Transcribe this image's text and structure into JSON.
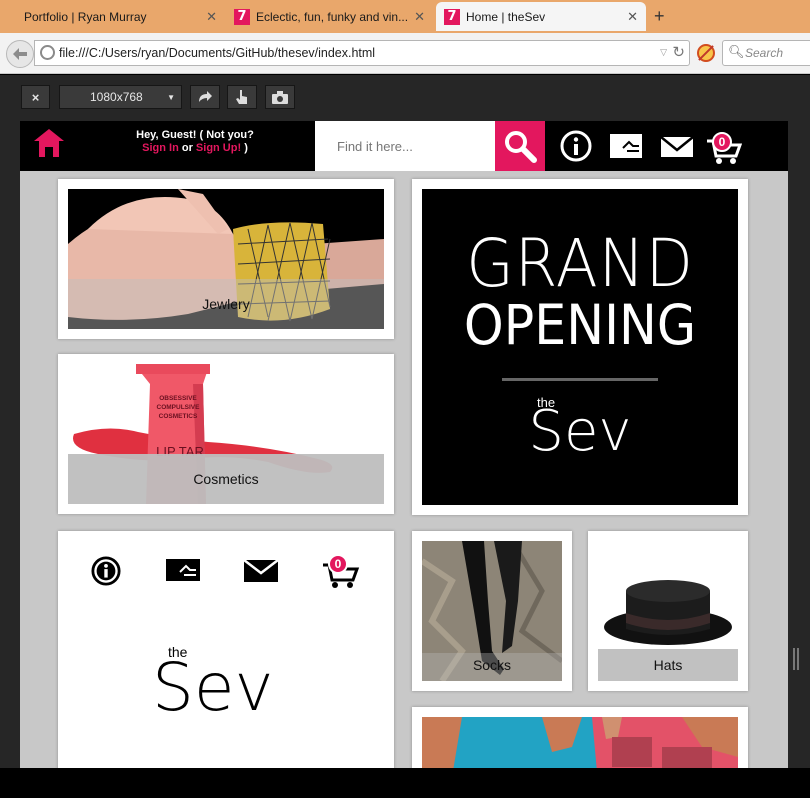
{
  "browser": {
    "tabs": [
      {
        "label": "Portfolio | Ryan Murray",
        "active": false
      },
      {
        "label": "Eclectic, fun, funky and vin...",
        "active": false
      },
      {
        "label": "Home | theSev",
        "active": true
      }
    ],
    "favicon_text": "7",
    "url": "file:///C:/Users/ryan/Documents/GitHub/thesev/index.html",
    "search_placeholder": "Search"
  },
  "responsive_toolbar": {
    "close_label": "×",
    "device_size": "1080x768"
  },
  "site": {
    "colors": {
      "accent": "#e3175e",
      "header_bg": "#000000",
      "tile_bg": "#ffffff",
      "page_bg": "#c8c8c8"
    },
    "header": {
      "greeting_line1": "Hey, Guest! ( Not you?",
      "sign_in": "Sign In",
      "or_text": "or",
      "sign_up": "Sign Up!",
      "close_paren": ")",
      "search_placeholder": "Find it here...",
      "icons": [
        "home-icon",
        "search-icon",
        "info-icon",
        "card-icon",
        "mail-icon",
        "cart-icon"
      ],
      "cart_count": "0"
    },
    "tiles": {
      "jewelry": {
        "label": "Jewlery"
      },
      "cosmetics": {
        "label": "Cosmetics",
        "tube_text": [
          "OBSESSIVE",
          "COMPULSIVE",
          "COSMETICS"
        ],
        "tube_brand": "LIP TAR"
      },
      "grand_opening": {
        "line1": "GRAND",
        "line2": "OPENING",
        "small": "the",
        "brand": "Sev"
      },
      "about": {
        "small": "the",
        "brand": "Sev",
        "cart_count": "0"
      },
      "socks": {
        "label": "Socks"
      },
      "hats": {
        "label": "Hats"
      }
    }
  }
}
